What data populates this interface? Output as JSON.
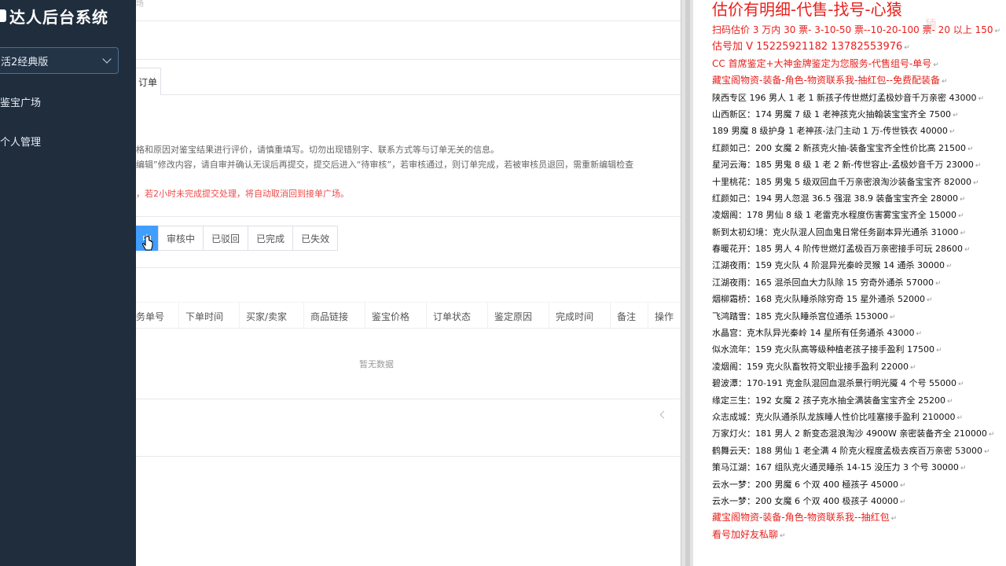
{
  "sidebar": {
    "brand": "达人后台系统",
    "version_select": "活2经典版",
    "items": [
      {
        "label": "鉴宝广场"
      },
      {
        "label": "个人管理"
      }
    ]
  },
  "main": {
    "breadcrumb": "场",
    "tab_label": "订单",
    "note_lines": [
      "格和原因对鉴宝结果进行评价，请慎重填写。切勿出现错别字、联系方式等与订单无关的信息。",
      "编辑”修改内容，请自审并确认无误后再提交，提交后进入“待审核”，若审核通过，则订单完成，若被审核员退回，需重新编辑检查",
      "，若2小时未完成提交处理，将自动取消回到接单广场。"
    ],
    "status_tabs": [
      "中",
      "审核中",
      "已驳回",
      "已完成",
      "已失效"
    ],
    "table_headers": [
      "务单号",
      "下单时间",
      "买家/卖家",
      "商品链接",
      "鉴宝价格",
      "订单状态",
      "鉴定原因",
      "完成时间",
      "备注",
      "操作"
    ],
    "empty_text": "暂无数据"
  },
  "doc": {
    "title": "估价有明细-代售-找号-心猿",
    "watermark": "猿",
    "lines": [
      {
        "text": "扫码估价 3 万内 30 票- 3-10-50 票--10-20-100 票- 20 以上 150",
        "style": "red"
      },
      {
        "text": "估号加 V 15225921182   13782553976",
        "style": "red big"
      },
      {
        "text": "CC 首席鉴定+大神金牌鉴定为您服务-代售组号-单号",
        "style": "red"
      },
      {
        "text": "藏宝阁物资-装备-角色-物资联系我-抽红包--免费配装备",
        "style": "red"
      },
      {
        "text": "陕西专区 196 男人 1 老 1 新孩子传世燃灯孟极妙音千万亲密 43000",
        "style": ""
      },
      {
        "text": "山西新区：174 男魔 7 级 1 老神孩克火抽翰装宝宝齐全 7500",
        "style": ""
      },
      {
        "text": "189 男魔 8 级护身 1 老神孩-法门主动 1 万-传世铁衣 40000",
        "style": ""
      },
      {
        "text": "红颜如己：200 女魔 2 新孩克火抽-装备宝宝齐全性价比高 21500",
        "style": ""
      },
      {
        "text": "星河云海：185 男鬼 8 级 1 老 2 新-传世容止-孟极妙音千万 23000",
        "style": ""
      },
      {
        "text": "十里桃花：185 男鬼 5 级双回血千万亲密浪淘沙装备宝宝齐 82000",
        "style": ""
      },
      {
        "text": "红颜如己：194 男人忽混 36.5 强混 38.9 装备宝宝齐全 28000",
        "style": ""
      },
      {
        "text": "凌烟阁：178 男仙 8 级 1 老雷克水程度伤害雾宝宝齐全 15000",
        "style": ""
      },
      {
        "text": "新到太初幻境：克火队混人回血鬼日常任务副本异光通杀 31000",
        "style": ""
      },
      {
        "text": "春暖花开：185 男人 4 阶传世燃灯孟极百万亲密接手可玩 28600",
        "style": ""
      },
      {
        "text": "江湖夜雨：159 克火队 4 阶混异光秦岭灵猴 14 通杀 30000",
        "style": ""
      },
      {
        "text": "江湖夜雨：165 混杀回血大力队除 15 穷奇外通杀 57000",
        "style": ""
      },
      {
        "text": "烟柳霜桥：168 克火队睡杀除穷奇 15 星外通杀 52000",
        "style": ""
      },
      {
        "text": "飞鸿踏雪：185 克火队睡杀宫位通杀 153000",
        "style": ""
      },
      {
        "text": "水晶宫：克木队异光秦岭 14 星所有任务通杀 43000",
        "style": ""
      },
      {
        "text": "似水流年：159 克火队高等级种植老孩子接手盈利 17500",
        "style": ""
      },
      {
        "text": "凌烟阁：159 克火队畜牧符文职业接手盈利 22000",
        "style": ""
      },
      {
        "text": "碧波潭：170-191 克金队混回血混杀景行明光魇 4 个号 55000",
        "style": ""
      },
      {
        "text": "缘定三生：192 女魔 2 孩子克水抽全满装备宝宝齐全 25200",
        "style": ""
      },
      {
        "text": "众志成城：克火队通杀队龙族睡人性价比哇塞接手盈利 210000",
        "style": ""
      },
      {
        "text": "万家灯火：181 男人 2 新变态混浪淘沙 4900W 亲密装备齐全 210000",
        "style": ""
      },
      {
        "text": "鹤舞云天：188 男仙 1 老全满 4 阶克火程度孟极去疾百万亲密 53000",
        "style": ""
      },
      {
        "text": "策马江湖：167 组队克火通灵睡杀 14-15 没压力 3 个号 30000",
        "style": ""
      },
      {
        "text": "云水一梦：200 男魔 6 个双 400 極孩子 45000",
        "style": ""
      },
      {
        "text": "云水一梦：200 女魔 6 个双 400 极孩子 40000",
        "style": ""
      },
      {
        "text": "藏宝阁物资-装备-角色-物资联系我--抽红包",
        "style": "red"
      },
      {
        "text": "看号加好友私聊",
        "style": "red"
      }
    ]
  }
}
